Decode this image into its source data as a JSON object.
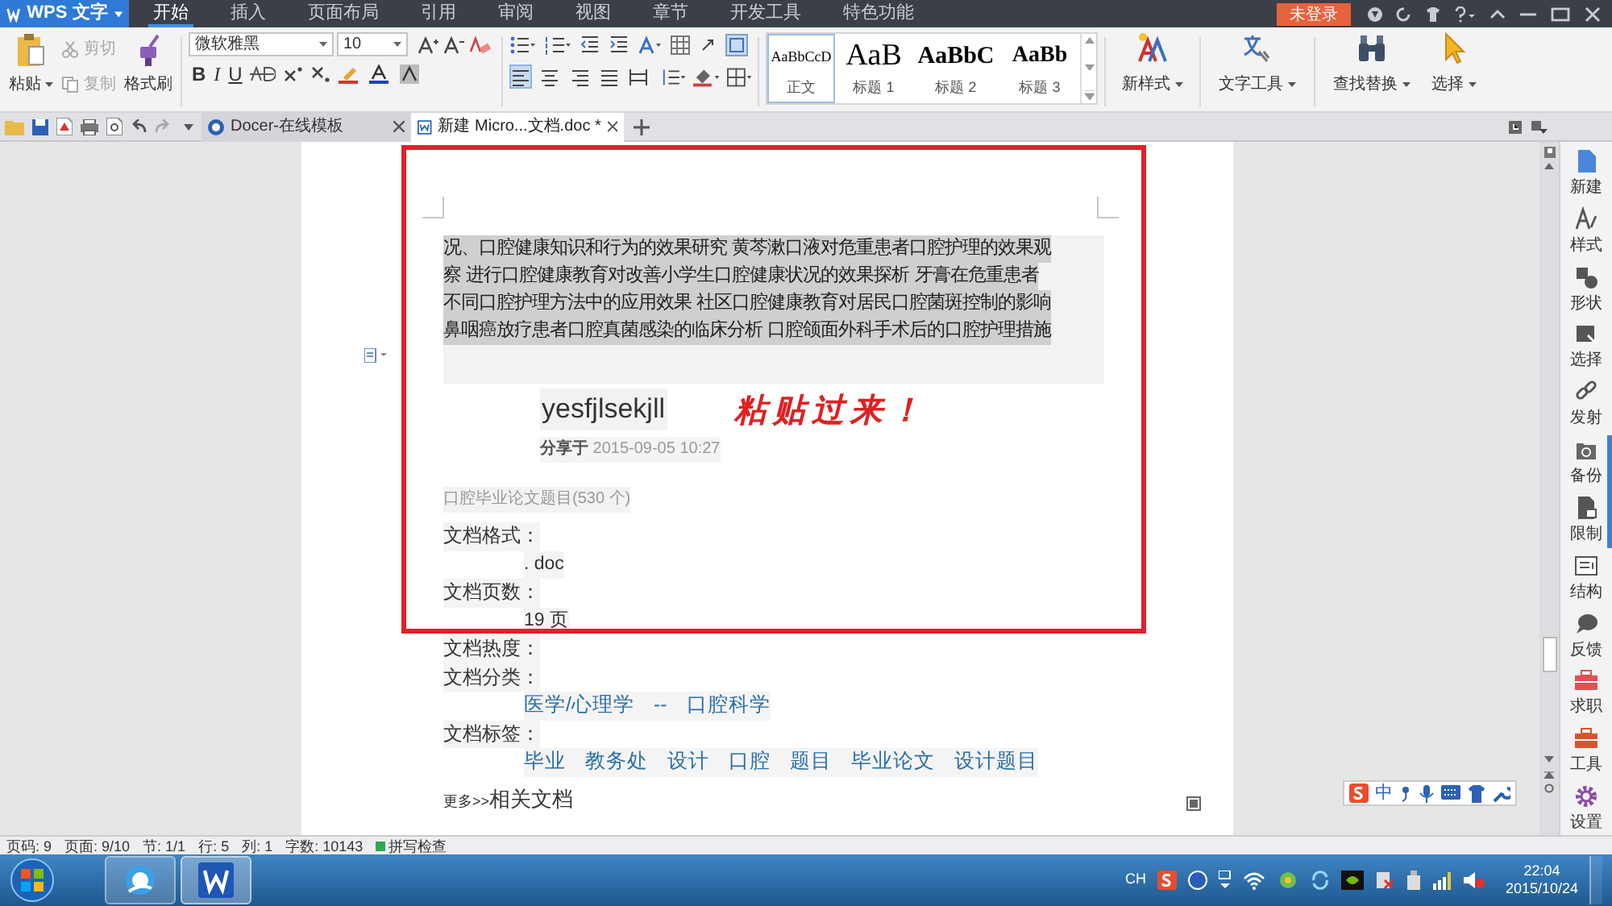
{
  "app_button": "WPS 文字",
  "menu_tabs": [
    {
      "label": "开始",
      "selected": true
    },
    {
      "label": "插入",
      "selected": false
    },
    {
      "label": "页面布局",
      "selected": false
    },
    {
      "label": "引用",
      "selected": false
    },
    {
      "label": "审阅",
      "selected": false
    },
    {
      "label": "视图",
      "selected": false
    },
    {
      "label": "章节",
      "selected": false
    },
    {
      "label": "开发工具",
      "selected": false
    },
    {
      "label": "特色功能",
      "selected": false
    }
  ],
  "login_button": "未登录",
  "ribbon": {
    "paste": "粘贴",
    "clipboard_actions": [
      {
        "label": "剪切",
        "disabled": true
      },
      {
        "label": "复制",
        "disabled": true
      }
    ],
    "format_painter": "格式刷",
    "font_name": "微软雅黑",
    "font_size": "10",
    "format_buttons": [
      "B",
      "I",
      "U"
    ],
    "paragraph_align": [
      {
        "selected": true
      },
      {
        "selected": false
      },
      {
        "selected": false
      },
      {
        "selected": false
      },
      {
        "selected": false
      }
    ],
    "styles": [
      {
        "preview": "AaBbCcD",
        "label": "正文",
        "selected": true
      },
      {
        "preview": "AaB",
        "label": "标题 1",
        "selected": false
      },
      {
        "preview": "AaBbC",
        "label": "标题 2",
        "selected": false
      },
      {
        "preview": "AaBb",
        "label": "标题 3",
        "selected": false
      }
    ],
    "tools": [
      "新样式",
      "文字工具",
      "查找替换",
      "选择"
    ]
  },
  "doc_tabs": [
    {
      "label": "Docer-在线模板",
      "selected": false
    },
    {
      "label": "新建 Micro...文档.doc *",
      "selected": true
    }
  ],
  "document": {
    "highlighted_lines": [
      "况、口腔健康知识和行为的效果研究 黄芩漱口液对危重患者口腔护理的效果观",
      "察 进行口腔健康教育对改善小学生口腔健康状况的效果探析 牙膏在危重患者",
      "不同口腔护理方法中的应用效果 社区口腔健康教育对居民口腔菌斑控制的影响",
      "鼻咽癌放疗患者口腔真菌感染的临床分析 口腔颌面外科手术后的口腔护理措施"
    ],
    "author": "yesfjlsekjll",
    "shared": "分享于",
    "shared_date": "2015-09-05 10:27",
    "collection": "口腔毕业论文题目(530 个)",
    "fields": [
      {
        "label": "文档格式：",
        "value": ". doc"
      },
      {
        "label": "文档页数：",
        "value": "19 页"
      },
      {
        "label": "文档热度："
      },
      {
        "label": "文档分类：",
        "links": [
          "医学/心理学",
          "--",
          "口腔科学"
        ]
      },
      {
        "label": "文档标签：",
        "links": [
          "毕业",
          "教务处",
          "设计",
          "口腔",
          "题目",
          "毕业论文",
          "设计题目"
        ]
      }
    ],
    "more": "更多>>",
    "related": "相关文档"
  },
  "annotation": "粘贴过来！",
  "sidebar": [
    "新建",
    "样式",
    "形状",
    "选择",
    "发射",
    "备份",
    "限制",
    "结构",
    "反馈",
    "求职",
    "工具",
    "设置"
  ],
  "ime_bar": "中",
  "status_bar": [
    "页码: 9",
    "页面: 9/10",
    "节: 1/1",
    "行: 5",
    "列: 1",
    "字数: 10143"
  ],
  "spell_check": "拼写检查",
  "taskbar": {
    "lang": "CH",
    "time": "22:04",
    "date": "2015/10/24"
  }
}
